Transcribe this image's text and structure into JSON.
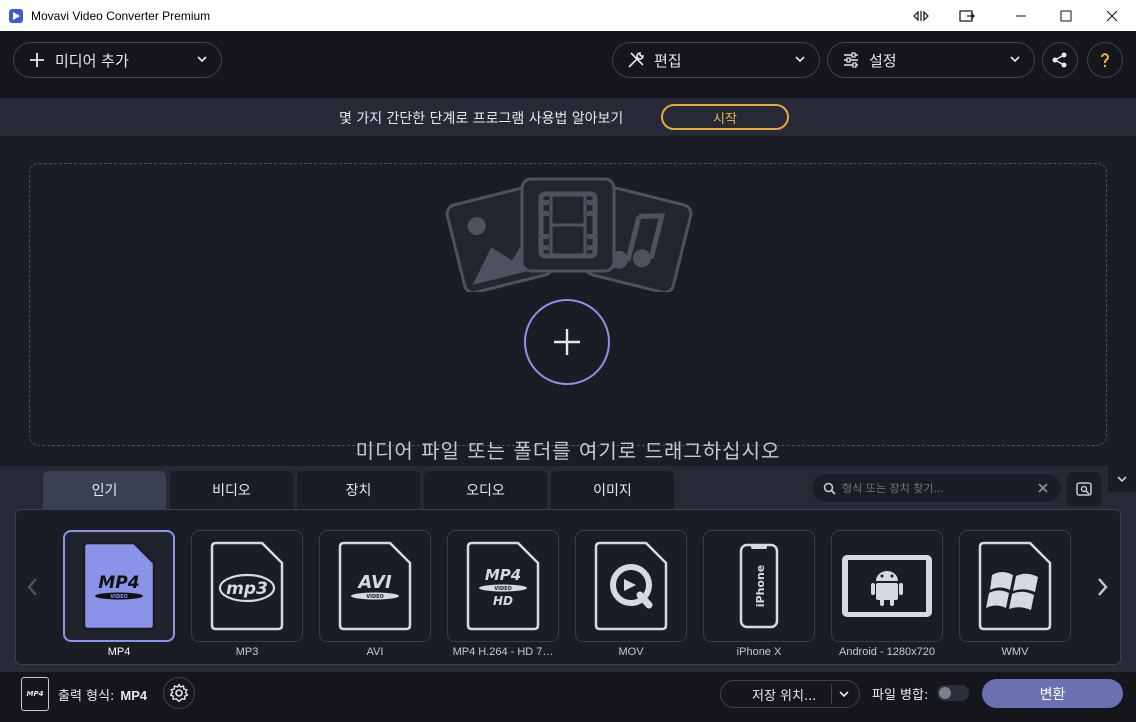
{
  "window": {
    "title": "Movavi Video Converter Premium",
    "controls": [
      "snap",
      "pip",
      "minimize",
      "maximize",
      "close"
    ]
  },
  "toolbar": {
    "add_media": {
      "label": "미디어 추가",
      "icon": "plus-icon"
    },
    "edit": {
      "label": "편집",
      "icon": "tools-icon"
    },
    "settings": {
      "label": "설정",
      "icon": "sliders-icon"
    },
    "share_icon": "share-icon",
    "help_icon": "help-icon"
  },
  "hint": {
    "text": "몇 가지 간단한 단계로 프로그램 사용법 알아보기",
    "start_label": "시작"
  },
  "dropzone": {
    "text": "미디어 파일 또는 폴더를 여기로 드래그하십시오"
  },
  "format_panel": {
    "tabs": [
      {
        "label": "인기",
        "active": true
      },
      {
        "label": "비디오",
        "active": false
      },
      {
        "label": "장치",
        "active": false
      },
      {
        "label": "오디오",
        "active": false
      },
      {
        "label": "이미지",
        "active": false
      }
    ],
    "search_placeholder": "형식 또는 장치 찾기...",
    "tiles": [
      {
        "label": "MP4",
        "badge": "MP4",
        "sub": "VIDEO",
        "selected": true
      },
      {
        "label": "MP3",
        "badge": "mp3",
        "selected": false
      },
      {
        "label": "AVI",
        "badge": "AVI",
        "sub": "VIDEO",
        "selected": false
      },
      {
        "label": "MP4 H.264 - HD 7…",
        "badge": "MP4",
        "sub": "VIDEO",
        "extra": "HD",
        "selected": false
      },
      {
        "label": "MOV",
        "badge": "quicktime",
        "selected": false
      },
      {
        "label": "iPhone X",
        "badge": "iPhone",
        "selected": false
      },
      {
        "label": "Android - 1280x720",
        "badge": "android",
        "selected": false
      },
      {
        "label": "WMV",
        "badge": "windows",
        "selected": false
      }
    ]
  },
  "bottom": {
    "output_label": "출력 형식:",
    "output_value": "MP4",
    "output_icon_text": "MP4",
    "save_label": "저장 위치...",
    "merge_label": "파일 병합:",
    "merge_on": false,
    "convert_label": "변환"
  },
  "colors": {
    "accent": "#8a93e8",
    "start_border": "#e7a83d",
    "convert_bg": "#6a70b0"
  }
}
